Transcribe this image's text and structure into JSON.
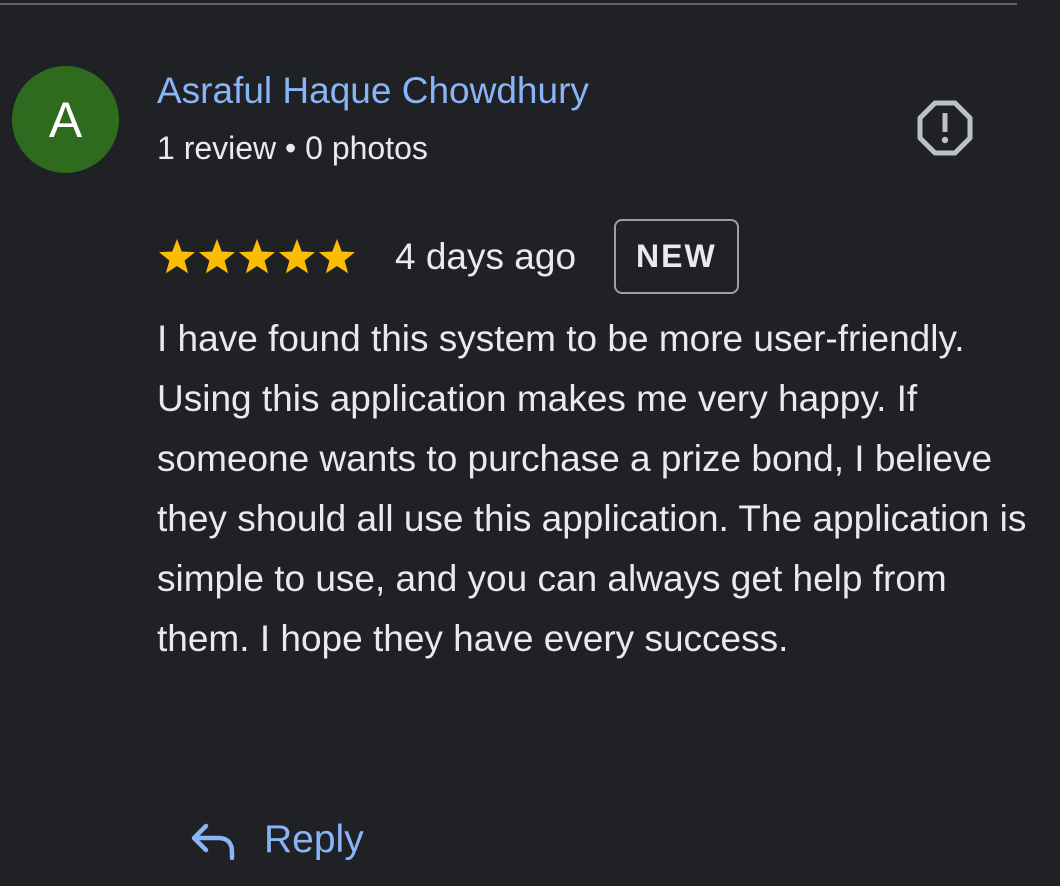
{
  "review": {
    "author": {
      "initial": "A",
      "name": "Asraful Haque Chowdhury",
      "meta": "1 review • 0 photos",
      "avatar_color": "#2e6b1f"
    },
    "rating": {
      "value": 5,
      "max": 5,
      "star_color": "#fbbc04",
      "icon": "star-icon"
    },
    "date": "4 days ago",
    "badge": "NEW",
    "text": "I have found this system to be more user-friendly. Using this application makes me very happy. If someone wants to purchase a prize bond, I believe they should all use this application. The application is simple to use, and you can always get help from them. I hope they have every success.",
    "report_icon": "report-flag-icon",
    "reply": {
      "label": "Reply",
      "icon": "reply-arrow-icon"
    }
  },
  "colors": {
    "background": "#202124",
    "link": "#8ab4f8",
    "text": "#e8eaed",
    "border": "#9aa0a6"
  }
}
